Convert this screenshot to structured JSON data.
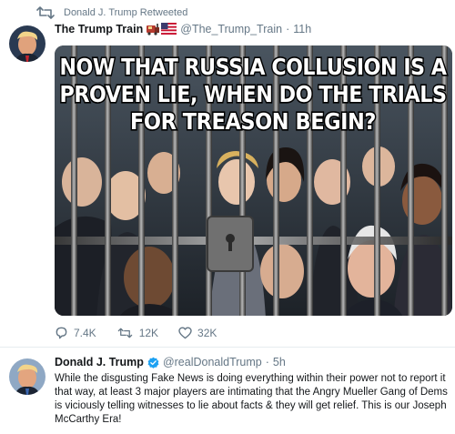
{
  "retweet_context": {
    "icon": "retweet-icon",
    "text": "Donald J. Trump Retweeted"
  },
  "tweets": [
    {
      "display_name": "The Trump Train",
      "name_emoji": [
        "train-emoji-icon",
        "us-flag-emoji-icon"
      ],
      "handle": "@The_Trump_Train",
      "separator": "·",
      "time": "11h",
      "media": {
        "caption_lines": [
          "NOW THAT RUSSIA COLLUSION IS A",
          "PROVEN LIE, WHEN DO THE TRIALS",
          "FOR TREASON BEGIN?"
        ]
      },
      "actions": [
        {
          "icon": "reply-icon",
          "count": "7.4K"
        },
        {
          "icon": "retweet-icon",
          "count": "12K"
        },
        {
          "icon": "like-heart-icon",
          "count": "32K"
        }
      ]
    },
    {
      "display_name": "Donald J. Trump",
      "verified": true,
      "handle": "@realDonaldTrump",
      "separator": "·",
      "time": "5h",
      "text": "While the disgusting Fake News is doing everything within their power not to report it that way, at least 3 major players are intimating that the Angry Mueller Gang of Dems is viciously telling witnesses to lie about facts & they will get relief. This is our Joseph McCarthy Era!"
    }
  ],
  "colors": {
    "text_primary": "#14171a",
    "text_secondary": "#657786",
    "verified_blue": "#1da1f2",
    "divider": "#e6ecf0"
  }
}
